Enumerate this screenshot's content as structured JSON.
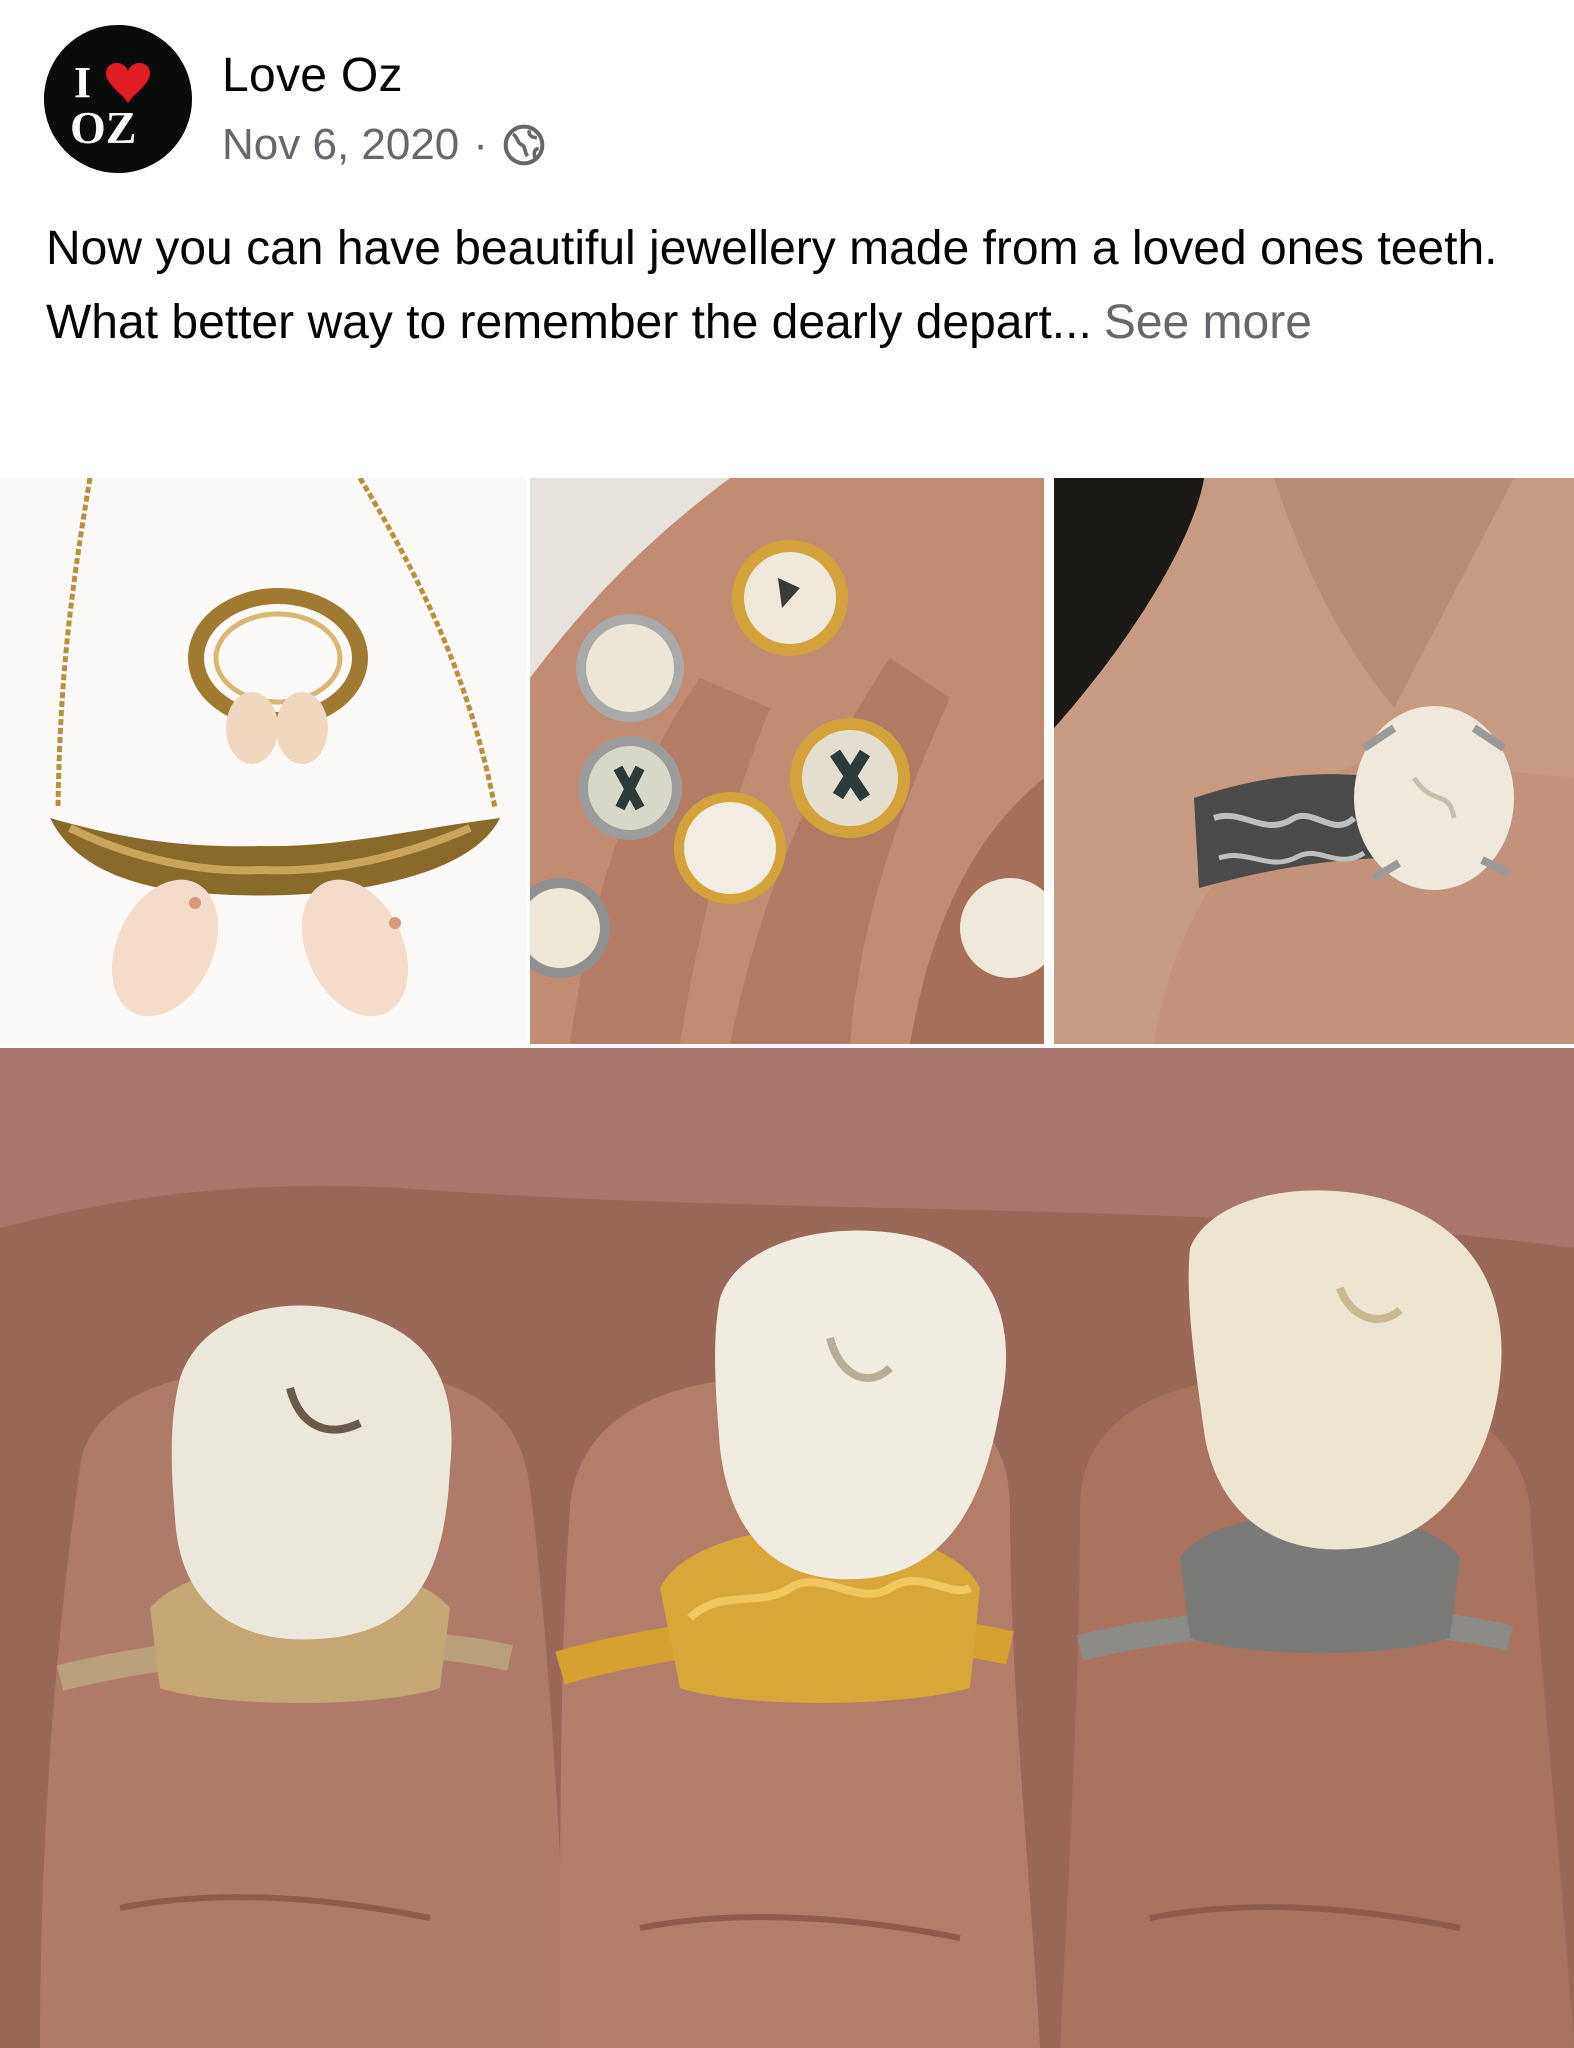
{
  "post": {
    "page_name": "Love Oz",
    "date": "Nov 6, 2020",
    "separator": "·",
    "privacy_icon": "globe-icon",
    "avatar_logo_text": "I ♥ OZ",
    "caption": "Now you can have beautiful jewellery made from a loved ones teeth. What better way to remember the dearly depart...",
    "see_more": "See more"
  },
  "photos": [
    {
      "icon": "photo-necklace-and-ring-with-teeth"
    },
    {
      "icon": "photo-hand-with-tooth-rings"
    },
    {
      "icon": "photo-silver-filigree-tooth-ring"
    },
    {
      "icon": "photo-three-fingers-tooth-rings"
    }
  ],
  "colors": {
    "text": "#050505",
    "secondary_text": "#65676b",
    "heart": "#e11d24"
  }
}
